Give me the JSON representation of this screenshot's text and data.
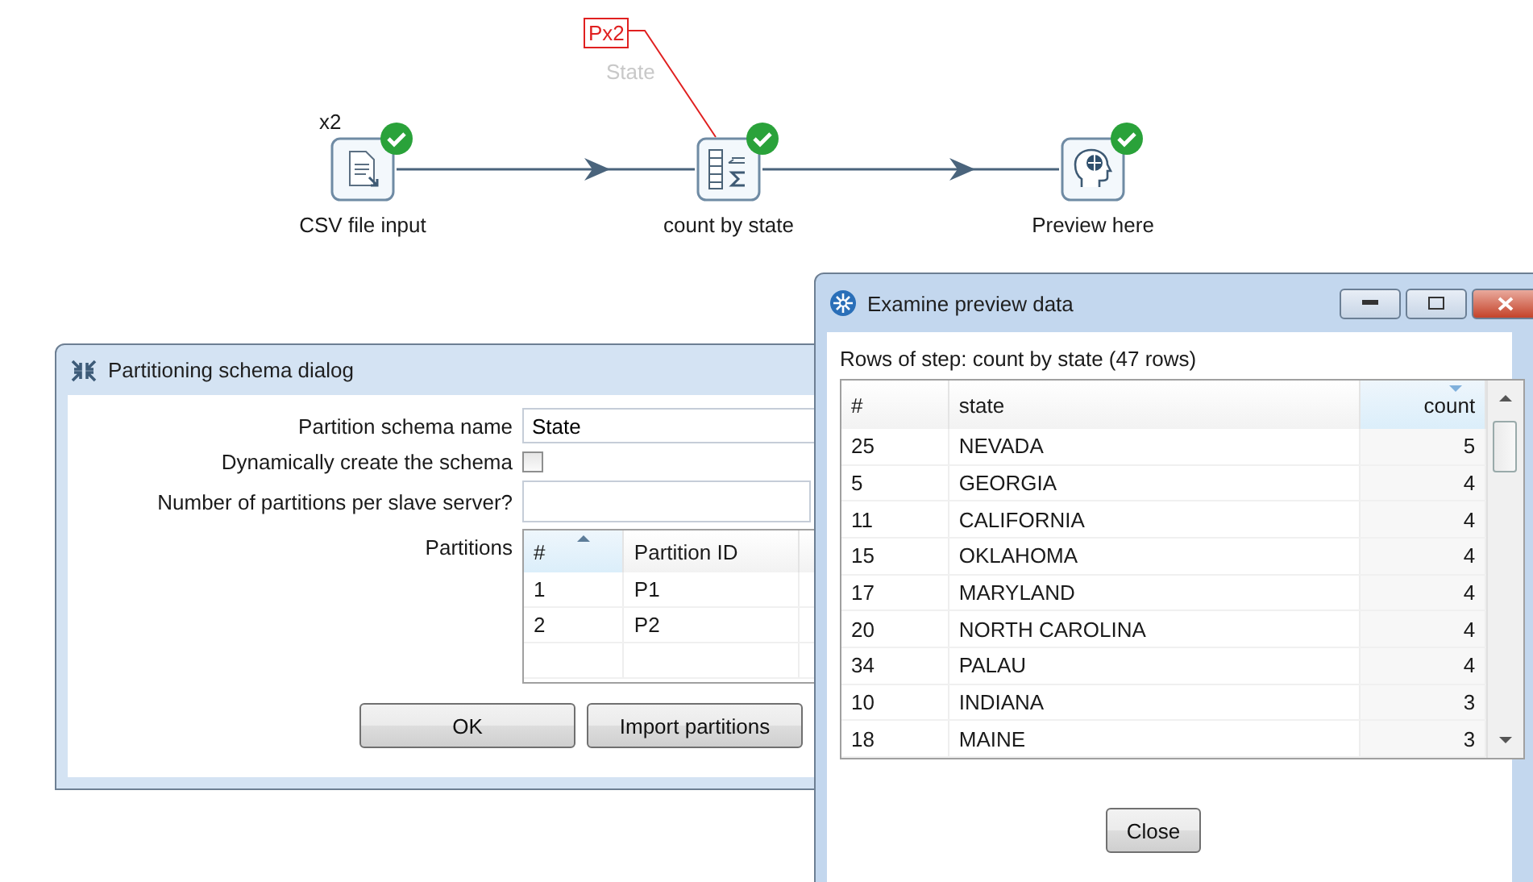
{
  "canvas": {
    "steps": [
      {
        "label": "CSV file input",
        "copies": "x2",
        "kind": "file",
        "done": true
      },
      {
        "label": "count by state",
        "kind": "group",
        "done": true,
        "partitioning": {
          "tag": "Px2",
          "schema": "State"
        }
      },
      {
        "label": "Preview here",
        "kind": "preview",
        "done": true
      }
    ]
  },
  "partition_dialog": {
    "title": "Partitioning schema dialog",
    "name_field": {
      "label": "Partition schema name",
      "value": "State"
    },
    "dynamic_checkbox": {
      "label": "Dynamically create the schema",
      "checked": false
    },
    "partitions_field": {
      "label": "Number of partitions per slave server?"
    },
    "partitions_table": {
      "label": "Partitions",
      "columns": [
        {
          "label": "#",
          "sorted": true
        },
        {
          "label": "Partition ID",
          "sorted": false
        }
      ],
      "rows": [
        [
          "1",
          "P1"
        ],
        [
          "2",
          "P2"
        ]
      ]
    },
    "buttons": [
      "OK",
      "Import partitions"
    ]
  },
  "preview_window": {
    "title": "Examine preview data",
    "caption": "Rows of step: count by state (47 rows)",
    "columns": [
      {
        "label": "#",
        "sorted": false
      },
      {
        "label": "state",
        "sorted": false
      },
      {
        "label": "count",
        "sorted": true
      }
    ],
    "rows": [
      [
        "25",
        "NEVADA",
        "5"
      ],
      [
        "5",
        "GEORGIA",
        "4"
      ],
      [
        "11",
        "CALIFORNIA",
        "4"
      ],
      [
        "15",
        "OKLAHOMA",
        "4"
      ],
      [
        "17",
        "MARYLAND",
        "4"
      ],
      [
        "20",
        "NORTH CAROLINA",
        "4"
      ],
      [
        "34",
        "PALAU",
        "4"
      ],
      [
        "10",
        "INDIANA",
        "3"
      ],
      [
        "18",
        "MAINE",
        "3"
      ]
    ],
    "buttons": [
      "Close"
    ]
  }
}
